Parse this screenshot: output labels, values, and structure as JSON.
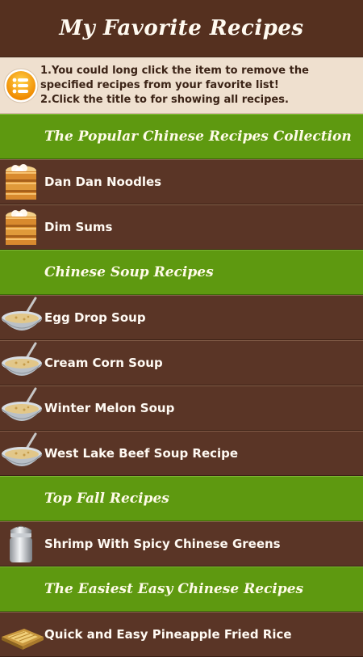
{
  "app": {
    "title": "My Favorite Recipes"
  },
  "info": {
    "icon": "list-icon",
    "line1": "1.You could long click the item to remove the specified recipes from your favorite list!",
    "line2": "2.Click the title to for showing all recipes."
  },
  "sections": [
    {
      "title": "The Popular Chinese Recipes Collection",
      "items": [
        {
          "label": "Dan Dan Noodles",
          "icon": "steamer-basket-icon"
        },
        {
          "label": "Dim Sums",
          "icon": "steamer-basket-icon"
        }
      ]
    },
    {
      "title": "Chinese Soup Recipes",
      "items": [
        {
          "label": "Egg Drop Soup",
          "icon": "soup-bowl-icon"
        },
        {
          "label": "Cream Corn Soup",
          "icon": "soup-bowl-icon"
        },
        {
          "label": "Winter Melon Soup",
          "icon": "soup-bowl-icon"
        },
        {
          "label": "West Lake Beef Soup Recipe",
          "icon": "soup-bowl-icon"
        }
      ]
    },
    {
      "title": "Top Fall Recipes",
      "items": [
        {
          "label": "Shrimp With Spicy Chinese Greens",
          "icon": "salt-shaker-icon"
        }
      ]
    },
    {
      "title": "The Easiest Easy Chinese Recipes",
      "items": [
        {
          "label": "Quick and Easy Pineapple Fried Rice",
          "icon": "fried-rice-tray-icon"
        }
      ]
    }
  ],
  "colors": {
    "header_bg": "#55301f",
    "item_bg": "#5a3526",
    "section_bg": "#5e9910",
    "info_bg": "#efe0cf"
  }
}
